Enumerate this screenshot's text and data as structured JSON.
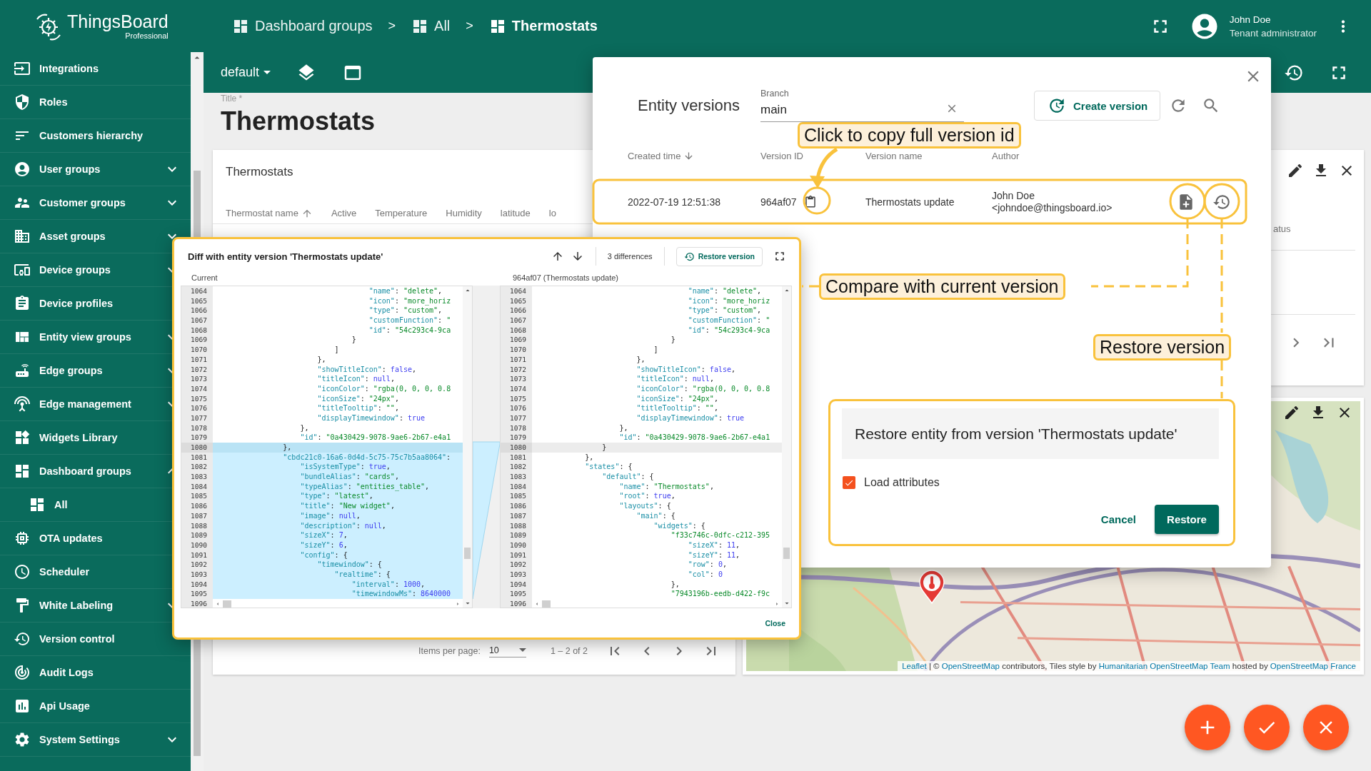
{
  "sidebar": {
    "logo": {
      "name": "ThingsBoard",
      "edition": "Professional"
    },
    "items": [
      {
        "label": "Integrations"
      },
      {
        "label": "Roles"
      },
      {
        "label": "Customers hierarchy"
      },
      {
        "label": "User groups",
        "expanded": false
      },
      {
        "label": "Customer groups",
        "expanded": false
      },
      {
        "label": "Asset groups",
        "expanded": false
      },
      {
        "label": "Device groups",
        "expanded": false
      },
      {
        "label": "Device profiles"
      },
      {
        "label": "Entity view groups",
        "expanded": false
      },
      {
        "label": "Edge groups",
        "expanded": false
      },
      {
        "label": "Edge management",
        "expanded": false
      },
      {
        "label": "Widgets Library"
      },
      {
        "label": "Dashboard groups",
        "expanded": true,
        "children": [
          {
            "label": "All"
          }
        ]
      },
      {
        "label": "OTA updates"
      },
      {
        "label": "Scheduler"
      },
      {
        "label": "White Labeling",
        "expanded": false
      },
      {
        "label": "Version control"
      },
      {
        "label": "Audit Logs"
      },
      {
        "label": "Api Usage"
      },
      {
        "label": "System Settings",
        "expanded": false
      }
    ]
  },
  "top_bar": {
    "breadcrumb": [
      {
        "label": "Dashboard groups",
        "current": false
      },
      {
        "separator": ">",
        "label": "All",
        "current": false
      },
      {
        "separator": ">",
        "label": "Thermostats",
        "current": true
      }
    ],
    "user": {
      "name": "John Doe",
      "role": "Tenant administrator"
    }
  },
  "toolbar": {
    "state": "default"
  },
  "dashboard": {
    "title_label": "Title *",
    "title": "Thermostats"
  },
  "table_widget": {
    "title": "Thermostats",
    "columns": [
      {
        "label": "Thermostat name",
        "sorted": true
      },
      {
        "label": "Active",
        "sorted": false
      },
      {
        "label": "Temperature",
        "sorted": false
      },
      {
        "label": "Humidity",
        "sorted": false
      },
      {
        "label": "latitude",
        "sorted": false
      },
      {
        "label": "lo",
        "sorted": false
      }
    ],
    "paginator": {
      "label": "Items per page:",
      "page_size": "10",
      "range": "1 – 2 of 2"
    }
  },
  "status_widget": {
    "column_label": "atus"
  },
  "map_widget": {
    "attribution": [
      {
        "text": "Leaflet",
        "link": true
      },
      {
        "text": " | © ",
        "link": false
      },
      {
        "text": "OpenStreetMap",
        "link": true
      },
      {
        "text": " contributors, Tiles style by ",
        "link": false
      },
      {
        "text": "Humanitarian OpenStreetMap Team",
        "link": true
      },
      {
        "text": " hosted by ",
        "link": false
      },
      {
        "text": "OpenStreetMap France",
        "link": true
      }
    ]
  },
  "entity_versions": {
    "title": "Entity versions",
    "branch": {
      "label": "Branch",
      "value": "main"
    },
    "create_button": "Create version",
    "columns": [
      {
        "label": "Created time",
        "sorted": true
      },
      {
        "label": "Version ID",
        "sorted": false
      },
      {
        "label": "Version name",
        "sorted": false
      },
      {
        "label": "Author",
        "sorted": false
      }
    ],
    "rows": [
      {
        "created_time": "2022-07-19 12:51:38",
        "version_id": "964af07",
        "version_name": "Thermostats update",
        "author_name": "John Doe",
        "author_email": "<johndoe@thingsboard.io>"
      }
    ]
  },
  "diff_dialog": {
    "title": "Diff with entity version 'Thermostats update'",
    "differences": "3 differences",
    "restore_button": "Restore version",
    "close_button": "Close",
    "panels": [
      {
        "label": "Current",
        "lines": [
          {
            "n": "1064",
            "text": "                                    \"name\": \"delete\",",
            "changed": false,
            "current": false
          },
          {
            "n": "1065",
            "text": "                                    \"icon\": \"more_horiz",
            "changed": false,
            "current": false
          },
          {
            "n": "1066",
            "text": "                                    \"type\": \"custom\",",
            "changed": false,
            "current": false
          },
          {
            "n": "1067",
            "text": "                                    \"customFunction\": \"",
            "changed": false,
            "current": false
          },
          {
            "n": "1068",
            "text": "                                    \"id\": \"54c293c4-9ca",
            "changed": false,
            "current": false
          },
          {
            "n": "1069",
            "text": "                                }",
            "changed": false,
            "current": false
          },
          {
            "n": "1070",
            "text": "                            ]",
            "changed": false,
            "current": false
          },
          {
            "n": "1071",
            "text": "                        },",
            "changed": false,
            "current": false
          },
          {
            "n": "1072",
            "text": "                        \"showTitleIcon\": false,",
            "changed": false,
            "current": false
          },
          {
            "n": "1073",
            "text": "                        \"titleIcon\": null,",
            "changed": false,
            "current": false
          },
          {
            "n": "1074",
            "text": "                        \"iconColor\": \"rgba(0, 0, 0, 0.8",
            "changed": false,
            "current": false
          },
          {
            "n": "1075",
            "text": "                        \"iconSize\": \"24px\",",
            "changed": false,
            "current": false
          },
          {
            "n": "1076",
            "text": "                        \"titleTooltip\": \"\",",
            "changed": false,
            "current": false
          },
          {
            "n": "1077",
            "text": "                        \"displayTimewindow\": true",
            "changed": false,
            "current": false
          },
          {
            "n": "1078",
            "text": "                    },",
            "changed": false,
            "current": false
          },
          {
            "n": "1079",
            "text": "                    \"id\": \"0a430429-9078-9ae6-2b67-e4a1",
            "changed": false,
            "current": false
          },
          {
            "n": "1080",
            "text": "                },",
            "changed": true,
            "current": true
          },
          {
            "n": "1081",
            "text": "                \"cbdc21c0-16a6-0d4d-5c75-75c7b5aa8064\":",
            "changed": true,
            "current": false
          },
          {
            "n": "1082",
            "text": "                    \"isSystemType\": true,",
            "changed": true,
            "current": false
          },
          {
            "n": "1083",
            "text": "                    \"bundleAlias\": \"cards\",",
            "changed": true,
            "current": false
          },
          {
            "n": "1084",
            "text": "                    \"typeAlias\": \"entities_table\",",
            "changed": true,
            "current": false
          },
          {
            "n": "1085",
            "text": "                    \"type\": \"latest\",",
            "changed": true,
            "current": false
          },
          {
            "n": "1086",
            "text": "                    \"title\": \"New widget\",",
            "changed": true,
            "current": false
          },
          {
            "n": "1087",
            "text": "                    \"image\": null,",
            "changed": true,
            "current": false
          },
          {
            "n": "1088",
            "text": "                    \"description\": null,",
            "changed": true,
            "current": false
          },
          {
            "n": "1089",
            "text": "                    \"sizeX\": 7,",
            "changed": true,
            "current": false
          },
          {
            "n": "1090",
            "text": "                    \"sizeY\": 6,",
            "changed": true,
            "current": false
          },
          {
            "n": "1091",
            "text": "                    \"config\": {",
            "changed": true,
            "current": false
          },
          {
            "n": "1092",
            "text": "                        \"timewindow\": {",
            "changed": true,
            "current": false
          },
          {
            "n": "1093",
            "text": "                            \"realtime\": {",
            "changed": true,
            "current": false
          },
          {
            "n": "1094",
            "text": "                                \"interval\": 1000,",
            "changed": true,
            "current": false
          },
          {
            "n": "1095",
            "text": "                                \"timewindowMs\": 8640000",
            "changed": true,
            "current": false
          },
          {
            "n": "1096",
            "changed": false,
            "current": false
          }
        ]
      },
      {
        "label": "964af07 (Thermostats update)",
        "lines": [
          {
            "n": "1064",
            "text": "                                    \"name\": \"delete\",",
            "changed": false,
            "current": false
          },
          {
            "n": "1065",
            "text": "                                    \"icon\": \"more_horiz",
            "changed": false,
            "current": false
          },
          {
            "n": "1066",
            "text": "                                    \"type\": \"custom\",",
            "changed": false,
            "current": false
          },
          {
            "n": "1067",
            "text": "                                    \"customFunction\": \"",
            "changed": false,
            "current": false
          },
          {
            "n": "1068",
            "text": "                                    \"id\": \"54c293c4-9ca",
            "changed": false,
            "current": false
          },
          {
            "n": "1069",
            "text": "                                }",
            "changed": false,
            "current": false
          },
          {
            "n": "1070",
            "text": "                            ]",
            "changed": false,
            "current": false
          },
          {
            "n": "1071",
            "text": "                        },",
            "changed": false,
            "current": false
          },
          {
            "n": "1072",
            "text": "                        \"showTitleIcon\": false,",
            "changed": false,
            "current": false
          },
          {
            "n": "1073",
            "text": "                        \"titleIcon\": null,",
            "changed": false,
            "current": false
          },
          {
            "n": "1074",
            "text": "                        \"iconColor\": \"rgba(0, 0, 0, 0.8",
            "changed": false,
            "current": false
          },
          {
            "n": "1075",
            "text": "                        \"iconSize\": \"24px\",",
            "changed": false,
            "current": false
          },
          {
            "n": "1076",
            "text": "                        \"titleTooltip\": \"\",",
            "changed": false,
            "current": false
          },
          {
            "n": "1077",
            "text": "                        \"displayTimewindow\": true",
            "changed": false,
            "current": false
          },
          {
            "n": "1078",
            "text": "                    },",
            "changed": false,
            "current": false
          },
          {
            "n": "1079",
            "text": "                    \"id\": \"0a430429-9078-9ae6-2b67-e4a1",
            "changed": false,
            "current": false
          },
          {
            "n": "1080",
            "text": "                }",
            "changed": false,
            "current": true
          },
          {
            "n": "1081",
            "text": "            },",
            "changed": false,
            "current": false
          },
          {
            "n": "1082",
            "text": "            \"states\": {",
            "changed": false,
            "current": false
          },
          {
            "n": "1083",
            "text": "                \"default\": {",
            "changed": false,
            "current": false
          },
          {
            "n": "1084",
            "text": "                    \"name\": \"Thermostats\",",
            "changed": false,
            "current": false
          },
          {
            "n": "1085",
            "text": "                    \"root\": true,",
            "changed": false,
            "current": false
          },
          {
            "n": "1086",
            "text": "                    \"layouts\": {",
            "changed": false,
            "current": false
          },
          {
            "n": "1087",
            "text": "                        \"main\": {",
            "changed": false,
            "current": false
          },
          {
            "n": "1088",
            "text": "                            \"widgets\": {",
            "changed": false,
            "current": false
          },
          {
            "n": "1089",
            "text": "                                \"f33c746c-0dfc-c212-395",
            "changed": false,
            "current": false
          },
          {
            "n": "1090",
            "text": "                                    \"sizeX\": 11,",
            "changed": false,
            "current": false
          },
          {
            "n": "1091",
            "text": "                                    \"sizeY\": 11,",
            "changed": false,
            "current": false
          },
          {
            "n": "1092",
            "text": "                                    \"row\": 0,",
            "changed": false,
            "current": false
          },
          {
            "n": "1093",
            "text": "                                    \"col\": 0",
            "changed": false,
            "current": false
          },
          {
            "n": "1094",
            "text": "                                },",
            "changed": false,
            "current": false
          },
          {
            "n": "1095",
            "text": "                                \"7943196b-eedb-d422-f9c",
            "changed": false,
            "current": false
          },
          {
            "n": "1096",
            "changed": false,
            "current": false
          }
        ]
      }
    ]
  },
  "restore_dialog": {
    "title": "Restore entity from version 'Thermostats update'",
    "load_attributes": {
      "label": "Load attributes",
      "checked": true
    },
    "cancel_button": "Cancel",
    "restore_button": "Restore"
  },
  "callouts": [
    {
      "text": "Click to copy full version id"
    },
    {
      "text": "Compare with current version"
    },
    {
      "text": "Restore version"
    }
  ]
}
